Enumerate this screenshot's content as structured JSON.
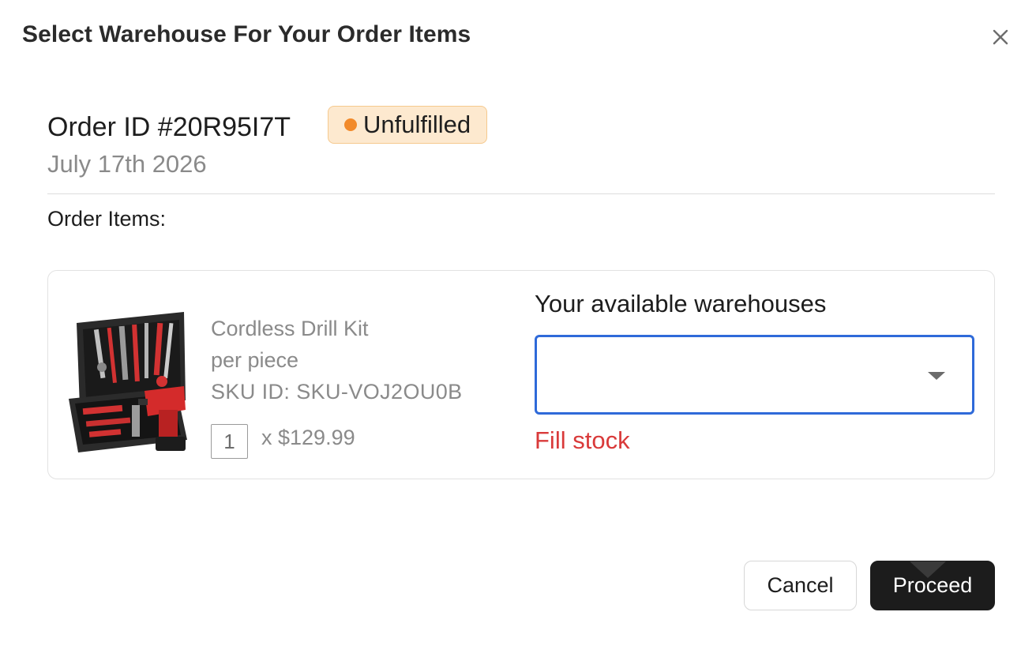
{
  "dialog": {
    "title": "Select Warehouse For Your Order Items",
    "close_icon": "close-icon"
  },
  "order": {
    "id_label": "Order ID #20R95I7T",
    "status": "Unfulfilled",
    "status_color": "#f28a2a",
    "date": "July 17th 2026"
  },
  "items_section": {
    "label": "Order Items:"
  },
  "item": {
    "image_icon": "drill-kit-image",
    "name": "Cordless Drill Kit",
    "unit": "per piece",
    "sku": "SKU ID: SKU-VOJ2OU0B",
    "quantity": "1",
    "price": "x $129.99"
  },
  "warehouse": {
    "label": "Your available warehouses",
    "selected": "",
    "error": "Fill stock",
    "error_color": "#d93a3a",
    "focus_color": "#2f6ad9"
  },
  "actions": {
    "cancel_label": "Cancel",
    "proceed_label": "Proceed"
  }
}
